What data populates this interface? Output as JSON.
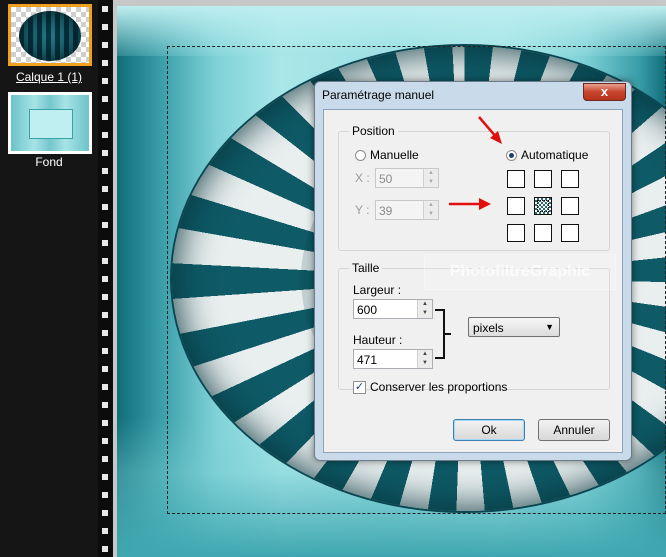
{
  "layers_panel": {
    "layers": [
      {
        "label": "Calque 1 (1)",
        "selected": true
      },
      {
        "label": "Fond",
        "selected": false
      }
    ]
  },
  "canvas": {
    "watermark": "PhotofiltreGraphic",
    "accent_color": "#0f6d79"
  },
  "dialog": {
    "title": "Paramétrage manuel",
    "close_glyph": "x",
    "position_group": {
      "title": "Position",
      "manual_label": "Manuelle",
      "auto_label": "Automatique",
      "selected_mode": "Automatique",
      "x_label": "X :",
      "x_value": "50",
      "y_label": "Y :",
      "y_value": "39",
      "anchor_selected": "center"
    },
    "size_group": {
      "title": "Taille",
      "width_label": "Largeur :",
      "width_value": "600",
      "height_label": "Hauteur :",
      "height_value": "471",
      "unit": "pixels",
      "keep_ratio_label": "Conserver les proportions",
      "keep_ratio_checked": true
    },
    "buttons": {
      "ok": "Ok",
      "cancel": "Annuler"
    }
  },
  "annotation_color": "#e01010"
}
